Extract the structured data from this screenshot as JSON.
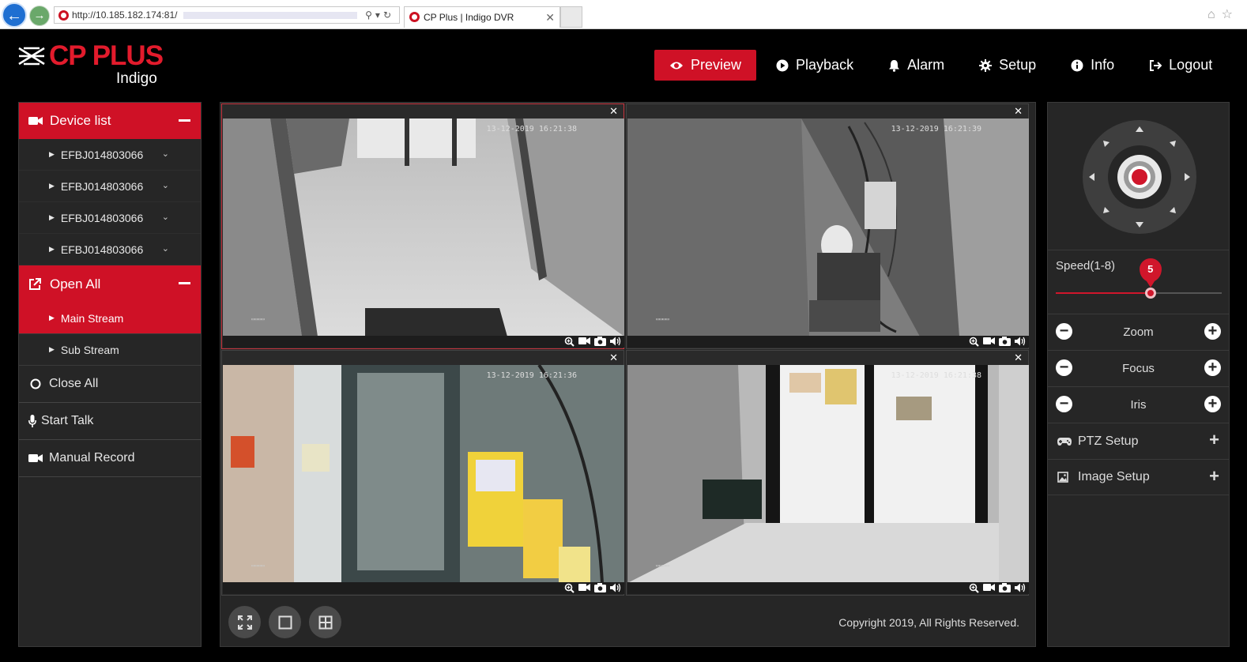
{
  "browser": {
    "url": "http://10.185.182.174:81/",
    "tab_title": "CP Plus | Indigo DVR"
  },
  "brand": {
    "name": "CP PLUS",
    "sub": "Indigo",
    "accent": "#cf1126"
  },
  "nav": {
    "preview": "Preview",
    "playback": "Playback",
    "alarm": "Alarm",
    "setup": "Setup",
    "info": "Info",
    "logout": "Logout"
  },
  "left": {
    "device_list": "Device list",
    "devices": [
      "EFBJ014803066",
      "EFBJ014803066",
      "EFBJ014803066",
      "EFBJ014803066"
    ],
    "open_all": "Open All",
    "main_stream": "Main Stream",
    "sub_stream": "Sub Stream",
    "close_all": "Close All",
    "start_talk": "Start Talk",
    "manual_record": "Manual Record"
  },
  "video": {
    "cells": [
      {
        "timestamp": "13-12-2019 16:21:38"
      },
      {
        "timestamp": "13-12-2019 16:21:39"
      },
      {
        "timestamp": "13-12-2019 16:21:36"
      },
      {
        "timestamp": "13-12-2019 16:21:38"
      }
    ],
    "copyright": "Copyright 2019, All Rights Reserved."
  },
  "ptz": {
    "speed_label": "Speed(1-8)",
    "speed_value": "5",
    "speed_fraction": 0.57,
    "zoom": "Zoom",
    "focus": "Focus",
    "iris": "Iris",
    "ptz_setup": "PTZ Setup",
    "image_setup": "Image Setup"
  }
}
